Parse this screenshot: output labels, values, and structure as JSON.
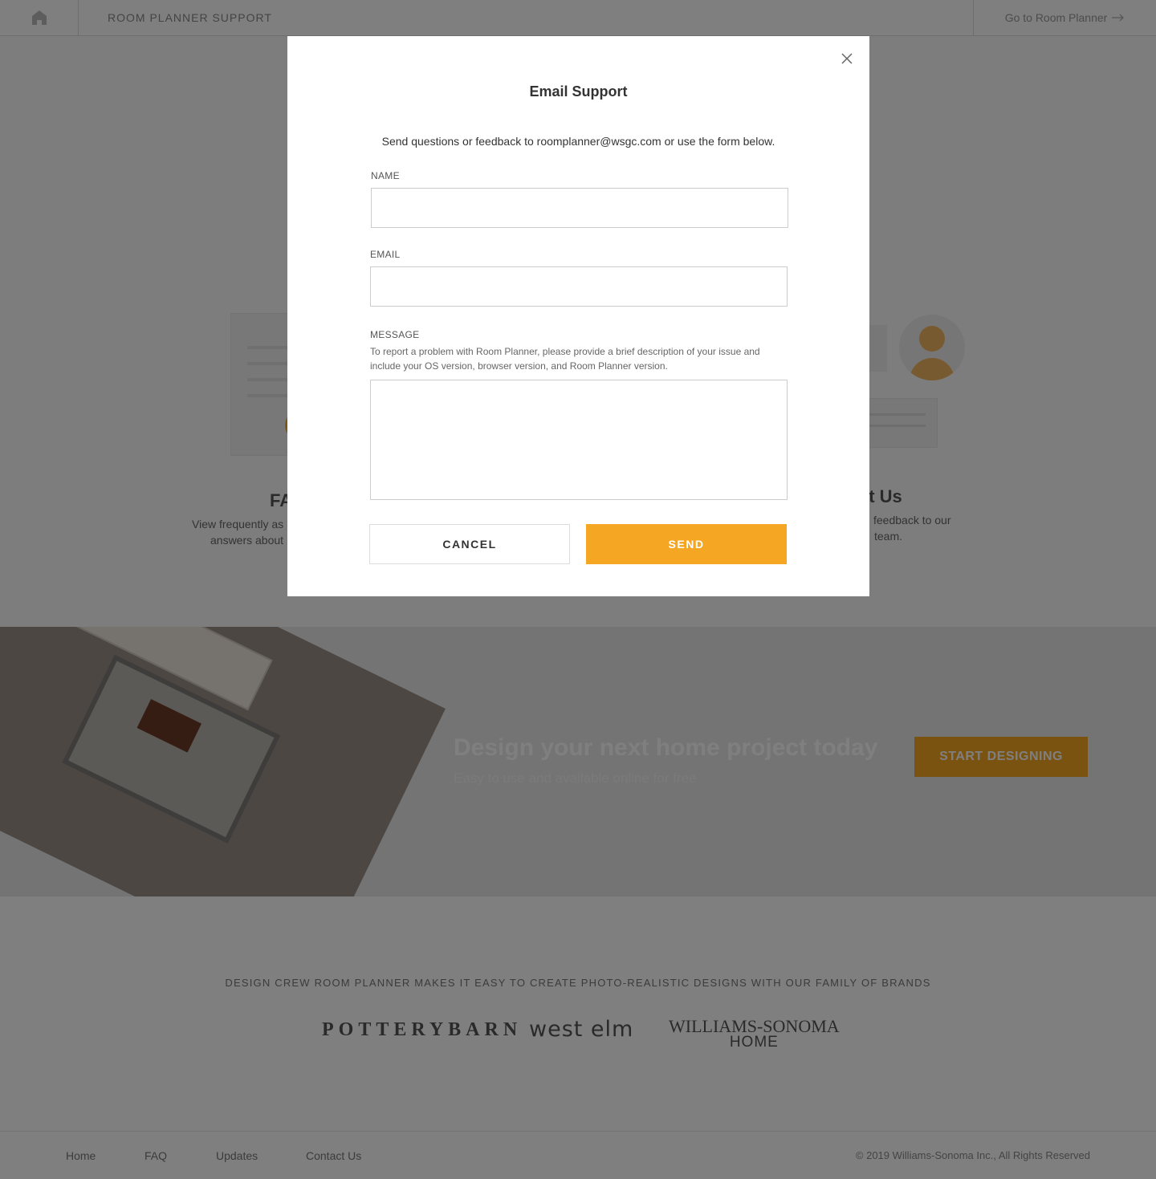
{
  "header": {
    "title": "ROOM PLANNER SUPPORT",
    "go_link": "Go to Room Planner"
  },
  "cards": {
    "faq": {
      "title": "FA",
      "desc_line1": "View frequently as",
      "desc_line2": "answers about"
    },
    "contact": {
      "title": "ct Us",
      "desc_line1": "feedback to our",
      "desc_line2": "team."
    }
  },
  "banner": {
    "title": "Design your next home project today",
    "subtitle": "Easy to use and available online for free",
    "cta": "START DESIGNING"
  },
  "brands": {
    "caption": "DESIGN CREW ROOM PLANNER MAKES IT EASY TO CREATE PHOTO-REALISTIC DESIGNS WITH OUR FAMILY OF BRANDS",
    "pottery_barn": "POTTERYBARN",
    "west_elm": "west elm",
    "williams_sonoma": "WILLIAMS-SONOMA",
    "williams_sonoma_home": "HOME"
  },
  "footer": {
    "links": [
      "Home",
      "FAQ",
      "Updates",
      "Contact Us"
    ],
    "copyright": "© 2019 Williams-Sonoma Inc., All Rights Reserved"
  },
  "modal": {
    "title": "Email Support",
    "intro": "Send questions or feedback to roomplanner@wsgc.com or use the form below.",
    "name_label": "NAME",
    "name_value": "",
    "email_label": "EMAIL",
    "email_value": "",
    "message_label": "MESSAGE",
    "message_help": "To report a problem with Room Planner, please provide a brief description of your issue and include your OS version, browser version, and Room Planner version.",
    "message_value": "",
    "cancel_label": "CANCEL",
    "send_label": "SEND"
  },
  "colors": {
    "accent": "#f5a623",
    "overlay": "rgba(0,0,0,0.5)"
  },
  "icons": {
    "home": "home-icon",
    "arrow": "arrow-right-icon",
    "close": "close-icon"
  }
}
